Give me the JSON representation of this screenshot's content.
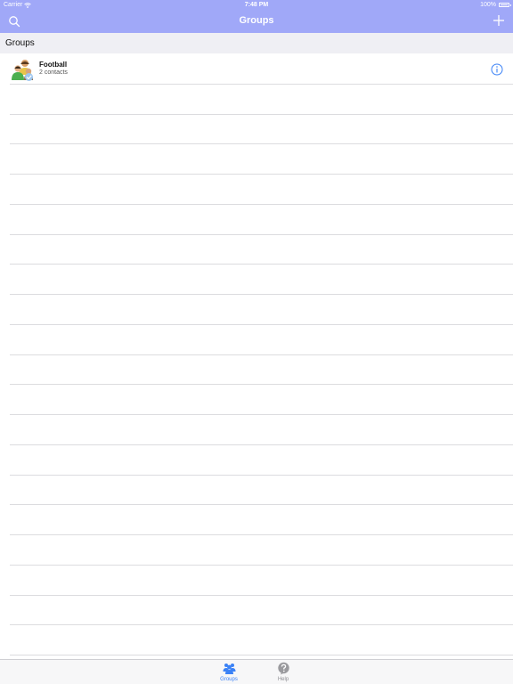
{
  "status_bar": {
    "carrier": "Carrier",
    "time": "7:48 PM",
    "battery": "100%"
  },
  "nav_bar": {
    "title": "Groups",
    "left_icon": "search-icon",
    "right_icon": "plus-icon"
  },
  "section": {
    "header": "Groups"
  },
  "groups": [
    {
      "name": "Football",
      "subtitle": "2 contacts",
      "icon": "group-avatar-icon",
      "accessory_icon": "info-icon"
    }
  ],
  "tab_bar": {
    "tabs": [
      {
        "label": "Groups",
        "icon": "people-icon",
        "selected": true
      },
      {
        "label": "Help",
        "icon": "question-icon",
        "selected": false
      }
    ]
  },
  "colors": {
    "nav_background": "#a0a8f8",
    "accent": "#3b82f6",
    "section_background": "#efeff4",
    "separator": "#dcdcdf"
  }
}
